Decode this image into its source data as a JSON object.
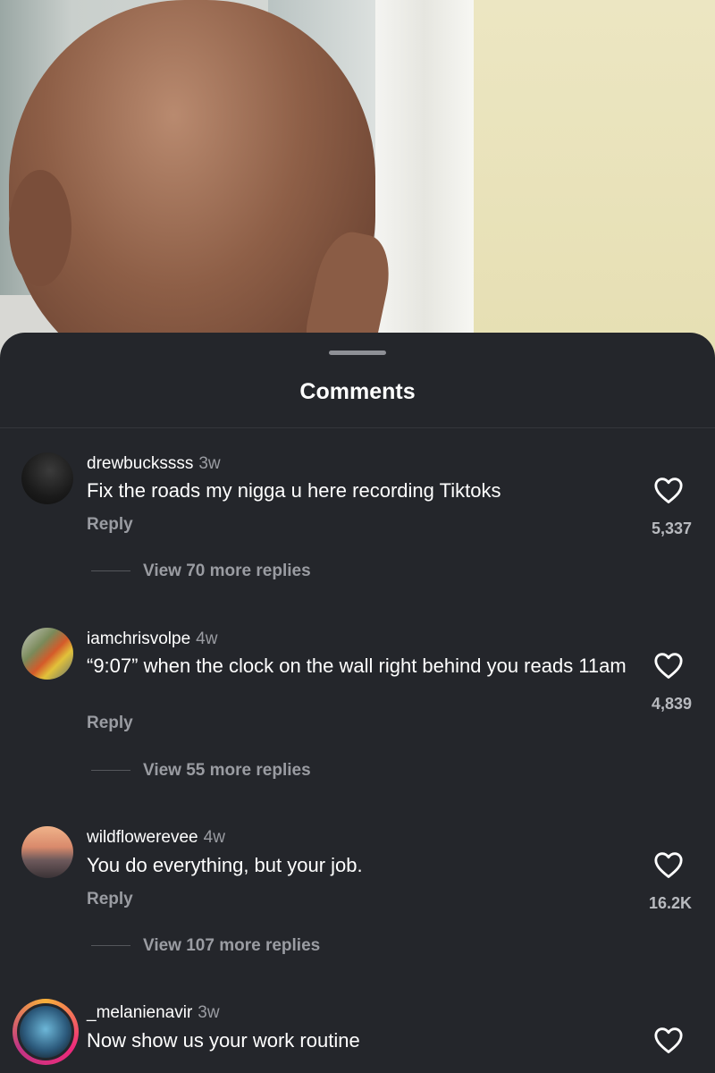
{
  "sheet": {
    "title": "Comments"
  },
  "comments": [
    {
      "username": "drewbuckssss",
      "time": "3w",
      "text": "Fix the roads my nigga u here recording Tiktoks",
      "reply_label": "Reply",
      "likes": "5,337",
      "view_more": "View 70 more replies"
    },
    {
      "username": "iamchrisvolpe",
      "time": "4w",
      "text": "“9:07” when the clock on the wall right behind you reads 11am",
      "reply_label": "Reply",
      "likes": "4,839",
      "view_more": "View 55 more replies"
    },
    {
      "username": "wildflowerevee",
      "time": "4w",
      "text": "You do everything, but your job.",
      "reply_label": "Reply",
      "likes": "16.2K",
      "view_more": "View 107 more replies"
    },
    {
      "username": "_melanienavir",
      "time": "3w",
      "text": "Now show us your work routine"
    }
  ],
  "icons": {
    "like": "heart-outline-icon",
    "handle": "drag-handle"
  },
  "colors": {
    "sheet_bg": "#24262b",
    "text_primary": "#ffffff",
    "text_secondary": "#9a9ca2"
  }
}
